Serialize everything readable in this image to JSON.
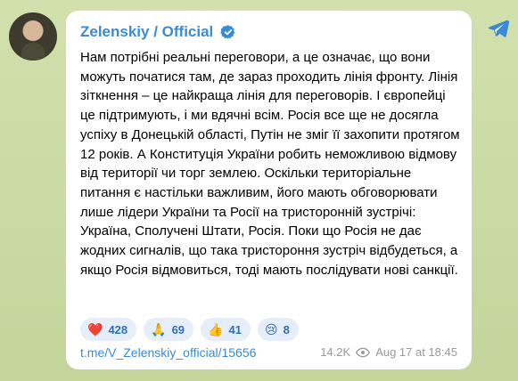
{
  "post": {
    "channel": "Zelenskiy / Official",
    "text": "Нам потрібні реальні переговори, а це означає, що вони можуть початися там, де зараз проходить лінія фронту. Лінія зіткнення – це найкраща лінія для переговорів. І європейці це підтримують, і ми вдячні всім. Росія все ще не досягла успіху в Донецькій області, Путін не зміг її захопити протягом 12 років. А Конституція України робить неможливою відмову від території чи торг землею. Оскільки територіальне питання є настільки важливим, його мають обговорювати лише лідери України та Росії на тристоронній зустрічі: Україна, Сполучені Штати, Росія. Поки що Росія не дає жодних сигналів, що така тристороння зустріч відбудеться, а якщо Росія відмовиться, тоді мають послідувати нові санкції.",
    "reactions": [
      {
        "emoji": "❤️",
        "count": "428"
      },
      {
        "emoji": "🙏",
        "count": "69"
      },
      {
        "emoji": "👍",
        "count": "41"
      },
      {
        "emoji": "😢",
        "count": "8"
      }
    ],
    "link": "t.me/V_Zelenskiy_official/15656",
    "views": "14.2K",
    "timestamp": "Aug 17 at 18:45"
  },
  "icons": {
    "verified": "verified-badge-icon",
    "views": "eye-icon",
    "share": "telegram-plane-icon"
  },
  "colors": {
    "accent": "#3a8bd6",
    "background": "#c9d9a6",
    "reaction_bg": "#e6eef9"
  }
}
